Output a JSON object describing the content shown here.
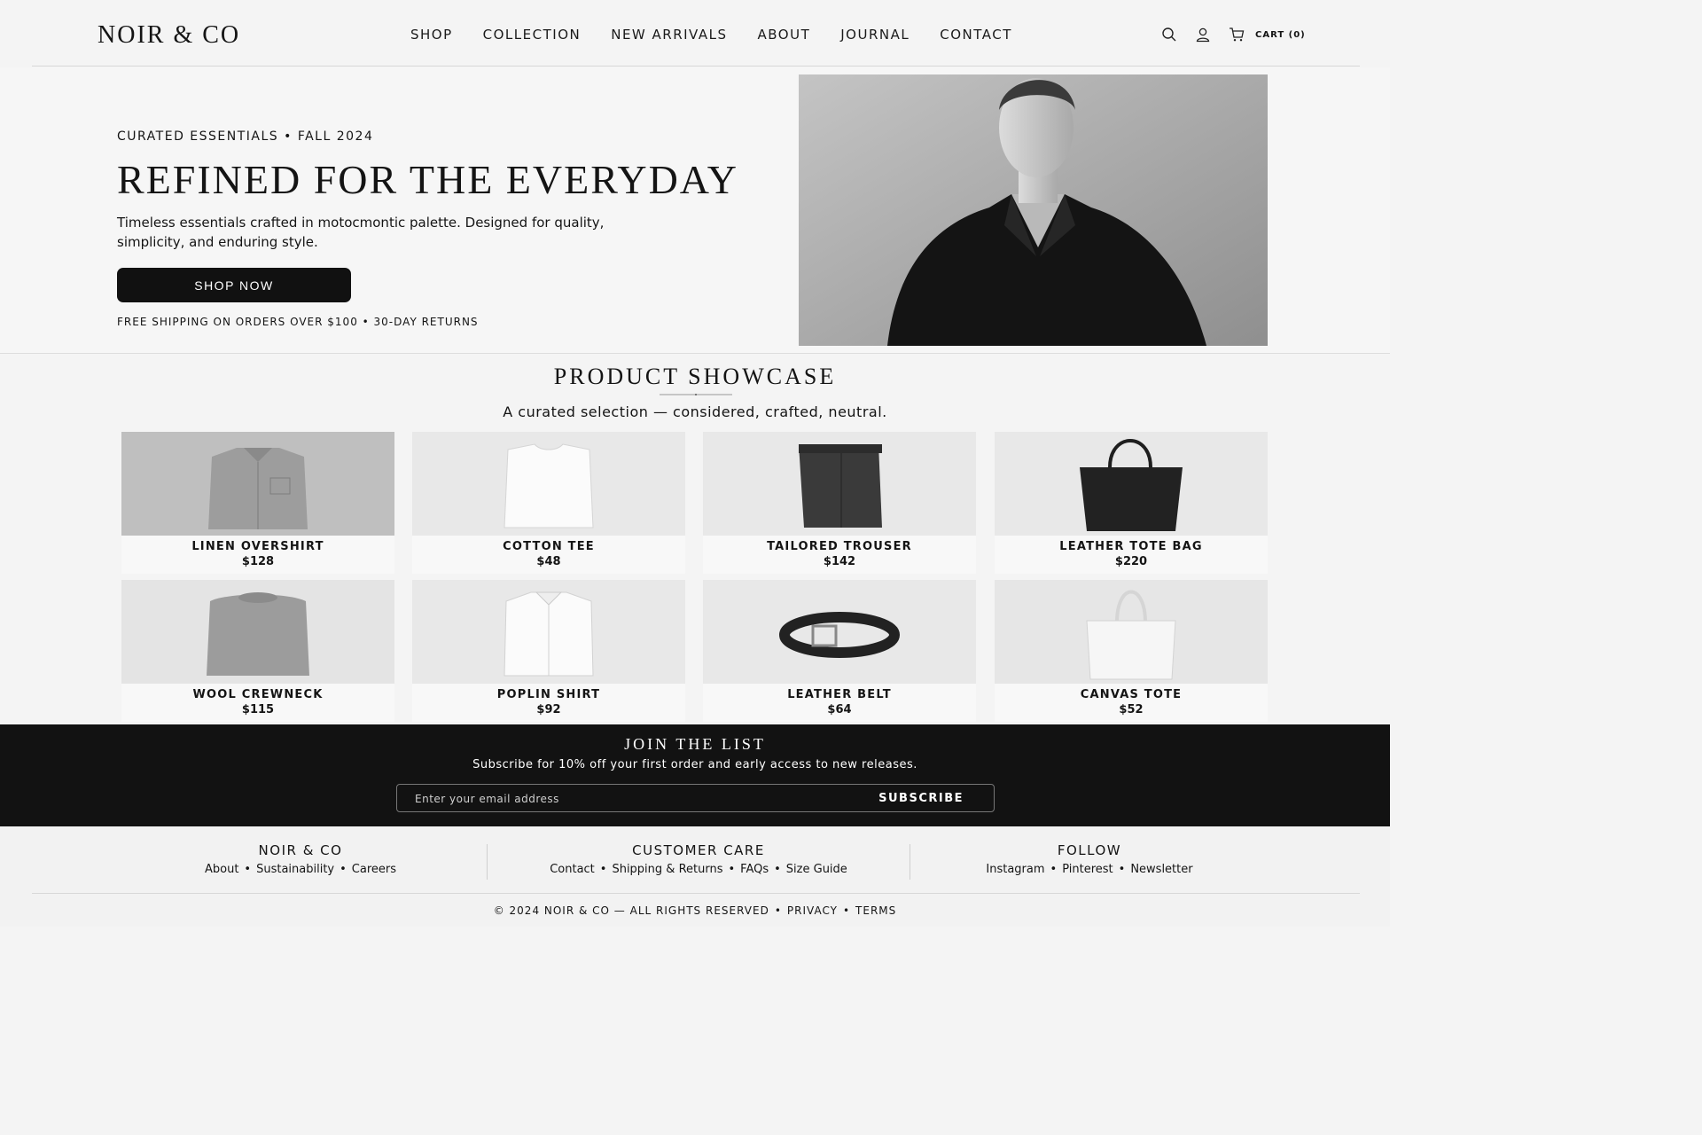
{
  "header": {
    "logo": "NOIR & CO",
    "nav": [
      "SHOP",
      "COLLECTION",
      "NEW ARRIVALS",
      "ABOUT",
      "JOURNAL",
      "CONTACT"
    ],
    "icons": [
      "search-icon",
      "account-icon",
      "cart-icon"
    ],
    "cart_label": "CART (0)"
  },
  "hero": {
    "eyebrow": "CURATED ESSENTIALS • FALL 2024",
    "title": "REFINED FOR THE EVERYDAY",
    "description": "Timeless essentials crafted in motocmontic palette. Designed for quality, simplicity, and enduring style.",
    "cta": "SHOP NOW",
    "note": "FREE SHIPPING ON ORDERS OVER $100 • 30-DAY RETURNS"
  },
  "showcase": {
    "title": "PRODUCT SHOWCASE",
    "subtitle": "A curated selection — considered, crafted, neutral.",
    "products": [
      {
        "name": "LINEN OVERSHIRT",
        "price": "$128",
        "icon": "overshirt-image"
      },
      {
        "name": "COTTON TEE",
        "price": "$48",
        "icon": "tee-image"
      },
      {
        "name": "TAILORED TROUSER",
        "price": "$142",
        "icon": "trouser-image"
      },
      {
        "name": "LEATHER TOTE BAG",
        "price": "$220",
        "icon": "leather-tote-image"
      },
      {
        "name": "WOOL CREWNECK",
        "price": "$115",
        "icon": "crewneck-image"
      },
      {
        "name": "POPLIN SHIRT",
        "price": "$92",
        "icon": "poplin-shirt-image"
      },
      {
        "name": "LEATHER BELT",
        "price": "$64",
        "icon": "belt-image"
      },
      {
        "name": "CANVAS TOTE",
        "price": "$52",
        "icon": "canvas-tote-image"
      }
    ]
  },
  "newsletter": {
    "title": "JOIN THE LIST",
    "subtitle": "Subscribe for 10% off your first order and early access to new releases.",
    "placeholder": "Enter your email address",
    "button": "SUBSCRIBE"
  },
  "footer": {
    "columns": [
      {
        "title": "NOIR & CO",
        "links": [
          "About",
          "Sustainability",
          "Careers"
        ]
      },
      {
        "title": "CUSTOMER CARE",
        "links": [
          "Contact",
          "Shipping & Returns",
          "FAQs",
          "Size Guide"
        ]
      },
      {
        "title": "FOLLOW",
        "links": [
          "Instagram",
          "Pinterest",
          "Newsletter"
        ]
      }
    ],
    "copyright": "© 2024 NOIR & CO — ALL RIGHTS RESERVED",
    "privacy": "PRIVACY",
    "terms": "TERMS",
    "separator": "•"
  },
  "colors": {
    "background": "#f4f4f4",
    "ink": "#141414",
    "button": "#111111",
    "newsletter_bg": "#121212"
  }
}
